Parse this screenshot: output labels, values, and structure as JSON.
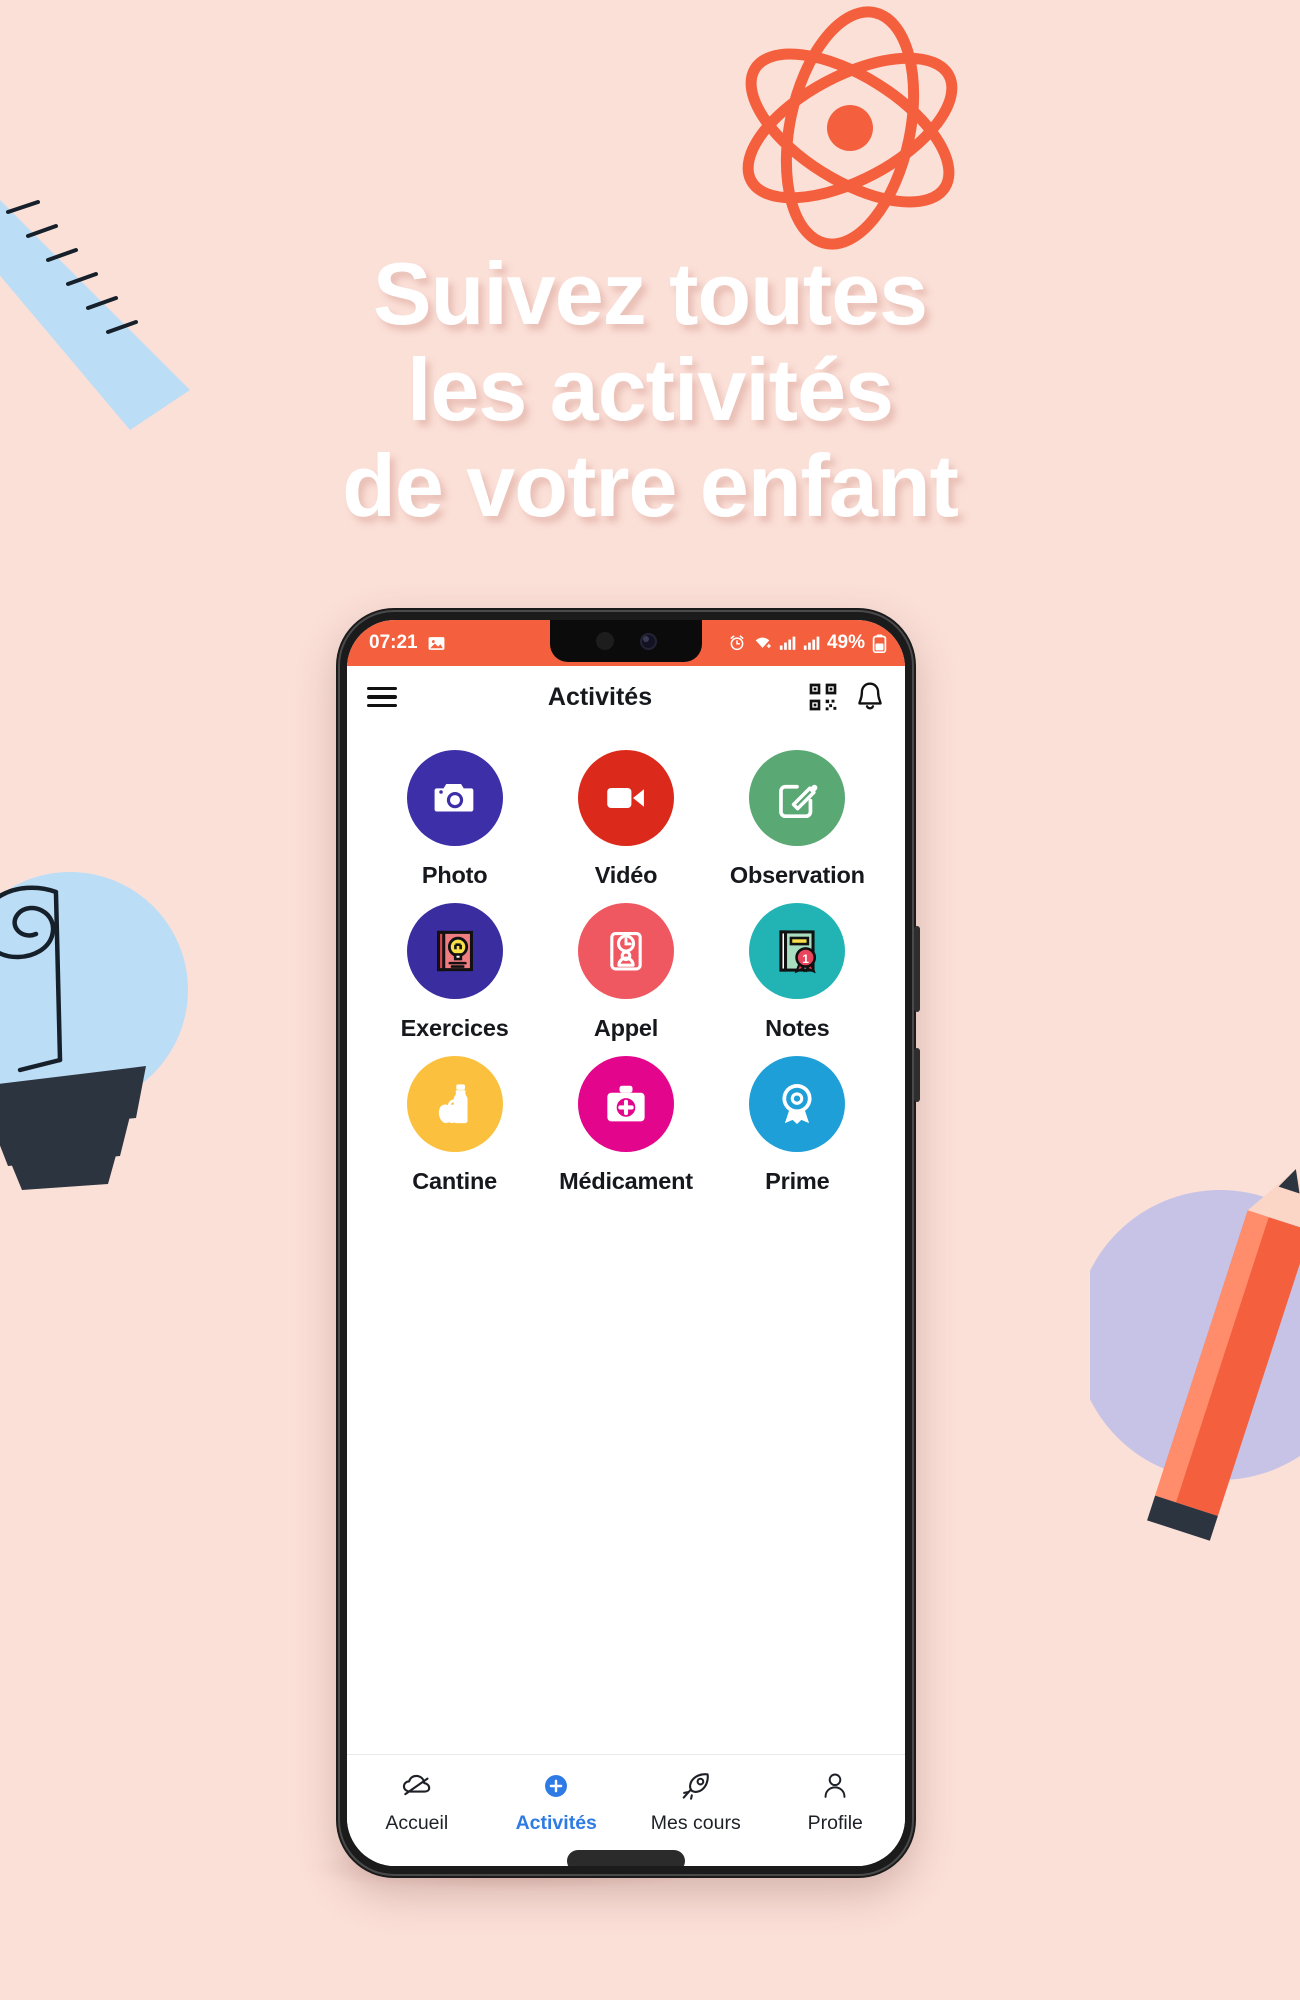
{
  "page": {
    "background_color": "#FBE0D8",
    "headline_lines": [
      "Suivez toutes",
      "les activités",
      "de votre enfant"
    ],
    "headline_color": "#FFFFFF"
  },
  "decorations": [
    {
      "name": "atom-illustration",
      "color": "#F4603E"
    },
    {
      "name": "ruler-illustration",
      "color": "#BCDDF6"
    },
    {
      "name": "lightbulb-illustration",
      "color": "#BCDDF6"
    },
    {
      "name": "pencil-illustration",
      "color": "#F4603E"
    }
  ],
  "phone": {
    "status_bar": {
      "time": "07:21",
      "left_icons": [
        "image-icon"
      ],
      "right_icons": [
        "alarm-icon",
        "wifi-icon",
        "signal-icon",
        "signal-icon"
      ],
      "battery": "49%",
      "background_color": "#F4603E"
    },
    "app_bar": {
      "menu_icon": "hamburger-menu-icon",
      "title": "Activités",
      "actions": [
        "qr-code-icon",
        "bell-icon"
      ]
    },
    "activities": [
      {
        "label": "Photo",
        "icon": "camera-icon",
        "color": "#3D2FA8"
      },
      {
        "label": "Vidéo",
        "icon": "video-camera-icon",
        "color": "#DB2A1C"
      },
      {
        "label": "Observation",
        "icon": "edit-square-icon",
        "color": "#5AA873"
      },
      {
        "label": "Exercices",
        "icon": "book-lightbulb-icon",
        "color": "#3A2DA0"
      },
      {
        "label": "Appel",
        "icon": "clipboard-clock-person-icon",
        "color": "#EF5761"
      },
      {
        "label": "Notes",
        "icon": "book-award-icon",
        "color": "#22B4B4"
      },
      {
        "label": "Cantine",
        "icon": "bottle-apple-icon",
        "color": "#FBC13E"
      },
      {
        "label": "Médicament",
        "icon": "medical-kit-icon",
        "color": "#E3058C"
      },
      {
        "label": "Prime",
        "icon": "award-medal-icon",
        "color": "#1F9FD8"
      }
    ],
    "bottom_nav": {
      "active_index": 1,
      "active_color": "#2F7BE5",
      "items": [
        {
          "label": "Accueil",
          "icon": "cloud-home-icon"
        },
        {
          "label": "Activités",
          "icon": "plus-circle-icon"
        },
        {
          "label": "Mes cours",
          "icon": "rocket-icon"
        },
        {
          "label": "Profile",
          "icon": "person-icon"
        }
      ]
    }
  }
}
